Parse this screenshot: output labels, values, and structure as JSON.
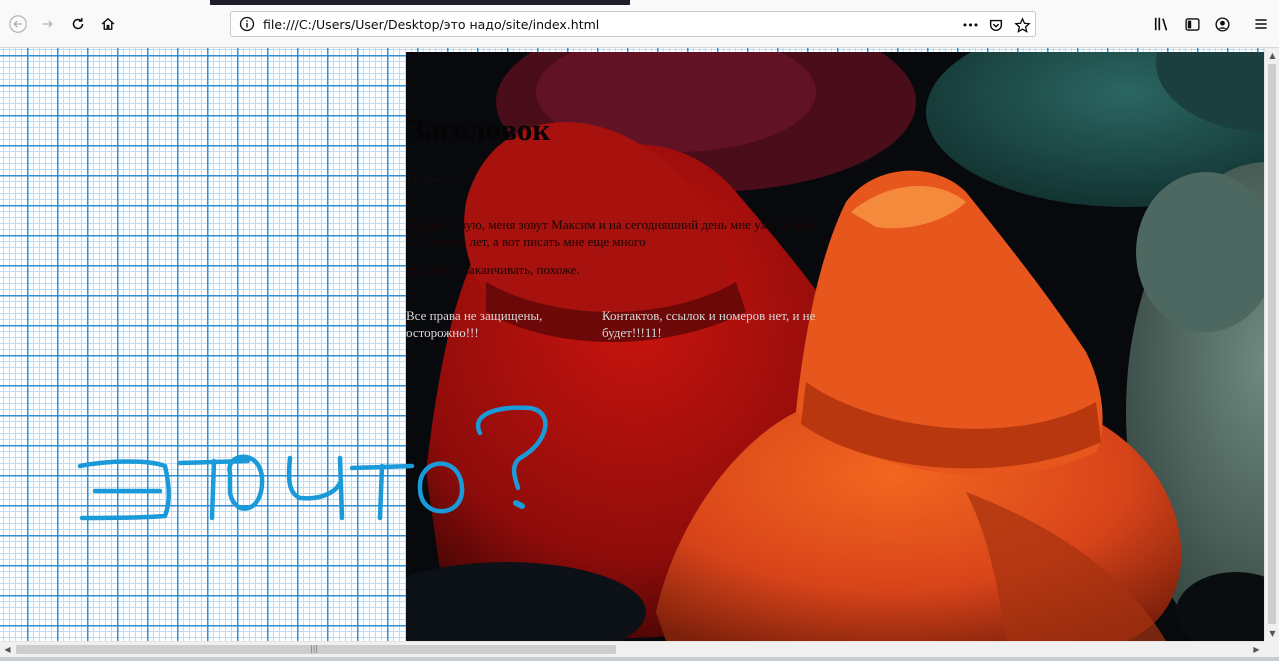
{
  "browser": {
    "url": "file:///C:/Users/User/Desktop/это надо/site/index.html",
    "nav_icons": [
      "back-arrow-icon",
      "forward-arrow-icon",
      "reload-icon",
      "home-icon"
    ],
    "url_icons": [
      "info-icon",
      "more-dots-icon",
      "pocket-icon",
      "bookmark-star-icon"
    ],
    "toolbar_icons": [
      "library-icon",
      "sidebar-icon",
      "account-icon",
      "menu-icon"
    ],
    "more_label": "•••"
  },
  "page": {
    "title": "Заголовок",
    "subtitle": "Пишем...",
    "paragraph": "Приветствую, меня зовут Максим и на сегодняшний день мне уже целых 15 полных лет, а вот писать мне еще много",
    "paragraph2": "Все, пора заканчивать, похоже.",
    "footer_left": "Все права не защищены, осторожно!!!",
    "footer_right": "Контактов, ссылок и номеров нет, и не будет!!!11!"
  },
  "annotation": {
    "text": "это что?",
    "color": "#1a9ad8"
  },
  "colors": {
    "grid_major": "#2d8fd6",
    "grid_minor": "#bfdcf3",
    "red_hat": "#b3120f",
    "orange_hat": "#e2501a",
    "teal_hat": "#1f5552"
  }
}
